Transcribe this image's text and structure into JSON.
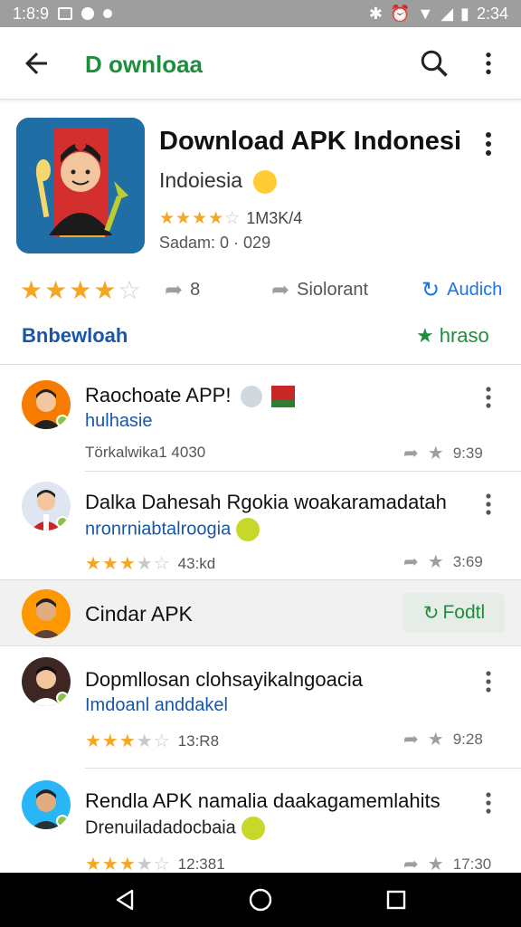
{
  "status_bar": {
    "time": "1:8:9",
    "clock": "2:34"
  },
  "app_bar": {
    "title": "D ownloaa",
    "icons": {
      "back": "back-arrow-icon",
      "search": "search-icon",
      "more": "more-vert-icon"
    }
  },
  "hero": {
    "title": "Download APK Indonesi",
    "subtitle": "Indoiesia",
    "rating_text": "1M3K/4",
    "date": "Sadam: 0 · 029",
    "rating_value": 3.5
  },
  "actions": {
    "stars_value": 4,
    "share_count": "8",
    "relevant_label": "Siolorant",
    "install_label": "Audich"
  },
  "section": {
    "left_label": "Bnbewloah",
    "right_label": "hraso"
  },
  "items": [
    {
      "title": "Raochoate APP!",
      "subtitle": "hulhasie",
      "meta": "Törkalwika1 4030",
      "time": "9:39",
      "stars": null
    },
    {
      "title": "Dalka Dahesah Rgokia woakaramadatah",
      "subtitle": "nronrniabtalroogia",
      "meta": "43:kd",
      "time": "3:69",
      "stars": 3
    },
    {
      "title": "Dopmllosan clohsayikalngoacia",
      "subtitle": "Imdoanl anddakel",
      "meta": "13:R8",
      "time": "9:28",
      "stars": 3
    },
    {
      "title": "Rendla APK namalia daakagamemlahits",
      "subtitle": "Drenuiladadocbaia",
      "meta": "12:381",
      "time": "17:30",
      "stars": 3
    }
  ],
  "band": {
    "title": "Cindar APK",
    "button": "Fodtl"
  },
  "nav": {
    "back": "nav-back-icon",
    "home": "nav-home-icon",
    "recents": "nav-recents-icon"
  },
  "colors": {
    "accent_green": "#1e8e3e",
    "link_blue": "#1a56a8",
    "star": "#f5a623"
  }
}
